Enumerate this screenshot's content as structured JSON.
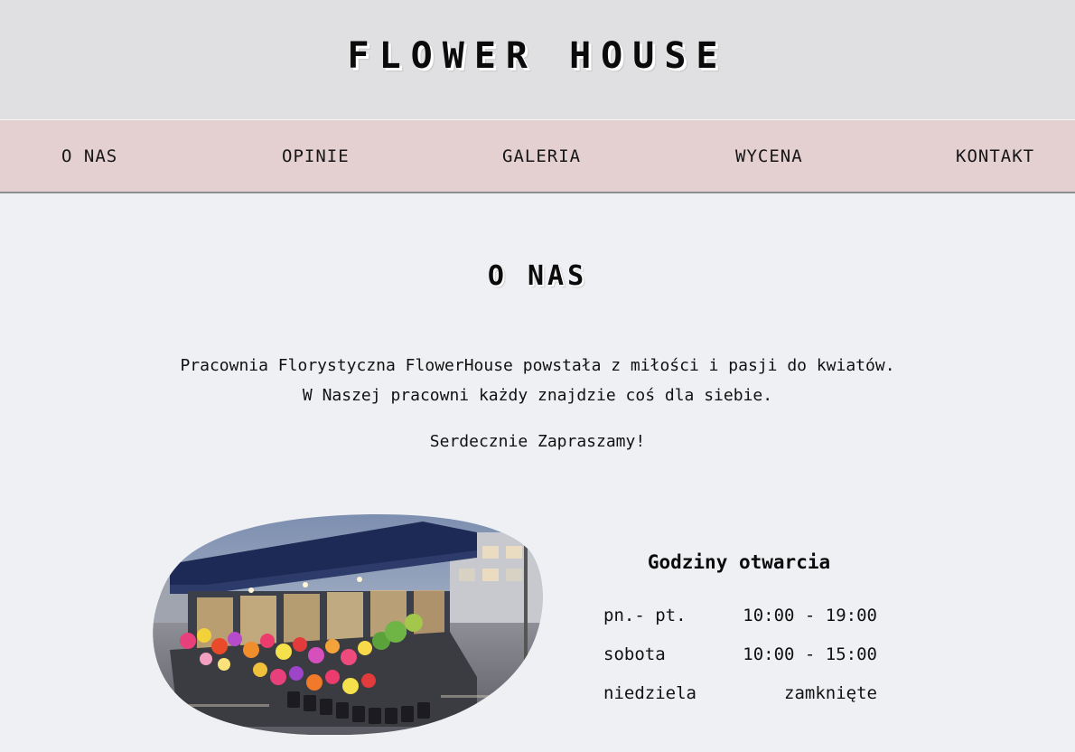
{
  "header": {
    "title": "FLOWER HOUSE"
  },
  "nav": {
    "items": [
      {
        "label": "O NAS"
      },
      {
        "label": "OPINIE"
      },
      {
        "label": "GALERIA"
      },
      {
        "label": "WYCENA"
      },
      {
        "label": "KONTAKT"
      }
    ]
  },
  "about": {
    "title": "O NAS",
    "paragraph": "Pracownia Florystyczna FlowerHouse powstała z miłości i pasji do kwiatów. W Naszej pracowni każdy znajdzie coś dla siebie.",
    "invite": "Serdecznie Zapraszamy!"
  },
  "hours": {
    "title": "Godziny otwarcia",
    "rows": [
      {
        "day": "pn.- pt.",
        "time": "10:00 - 19:00"
      },
      {
        "day": "sobota",
        "time": "10:00 - 15:00"
      },
      {
        "day": "niedziela",
        "time": "zamknięte"
      }
    ]
  },
  "colors": {
    "header_bg": "#e0e0e3",
    "nav_bg": "#e4cfd1",
    "page_bg": "#eff0f4"
  }
}
